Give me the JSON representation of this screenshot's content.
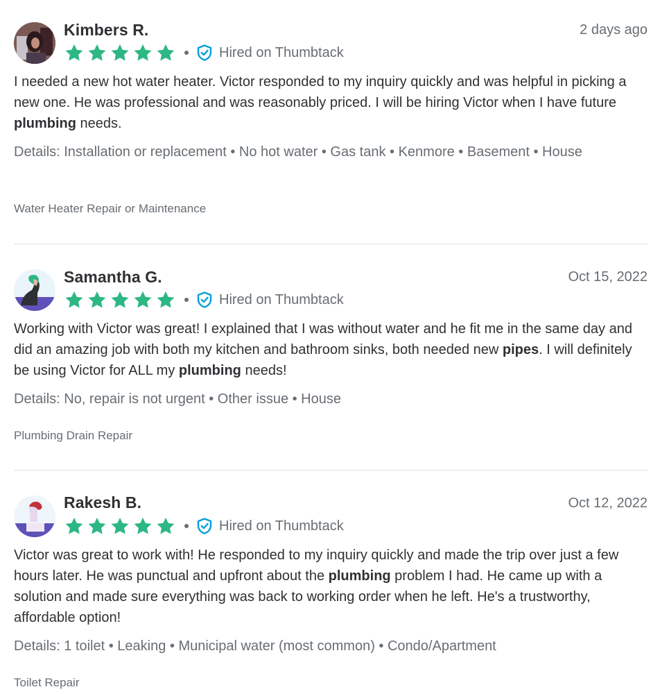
{
  "reviews": [
    {
      "name": "Kimbers R.",
      "date": "2 days ago",
      "rating": 5,
      "hired_label": "Hired on Thumbtack",
      "body": [
        {
          "t": "I needed a new hot water heater. Victor responded to my inquiry quickly and was helpful in picking a new one. He was professional and was reasonably priced. I will be hiring Victor when I have future ",
          "b": false
        },
        {
          "t": "plumbing",
          "b": true
        },
        {
          "t": " needs.",
          "b": false
        }
      ],
      "details": "Details: Installation or replacement • No hot water • Gas tank • Kenmore • Basement • House",
      "category": "Water Heater Repair or Maintenance",
      "avatar": "photo"
    },
    {
      "name": "Samantha G.",
      "date": "Oct 15, 2022",
      "rating": 5,
      "hired_label": "Hired on Thumbtack",
      "body": [
        {
          "t": "Working with Victor was great! I explained that I was without water and he fit me in the same day and did an amazing job with both my kitchen and bathroom sinks, both needed new ",
          "b": false
        },
        {
          "t": "pipes",
          "b": true
        },
        {
          "t": ". I will definitely be using Victor for ALL my ",
          "b": false
        },
        {
          "t": "plumbing",
          "b": true
        },
        {
          "t": " needs!",
          "b": false
        }
      ],
      "details": "Details: No, repair is not urgent • Other issue • House",
      "category": "Plumbing Drain Repair",
      "avatar": "illustration-green"
    },
    {
      "name": "Rakesh B.",
      "date": "Oct 12, 2022",
      "rating": 5,
      "hired_label": "Hired on Thumbtack",
      "body": [
        {
          "t": "Victor was great to work with! He responded to my inquiry quickly and made the trip over just a few hours later. He was punctual and upfront about the ",
          "b": false
        },
        {
          "t": "plumbing",
          "b": true
        },
        {
          "t": " problem I had. He came up with a solution and made sure everything was back to working order when he left. He's a trustworthy, affordable option!",
          "b": false
        }
      ],
      "details": "Details: 1 toilet • Leaking • Municipal water (most common) • Condo/Apartment",
      "category": "Toilet Repair",
      "avatar": "illustration-red"
    }
  ],
  "colors": {
    "star": "#2db783",
    "shield": "#009fd9",
    "muted_text": "#676d73",
    "body_text": "#2f3033",
    "divider": "#e0e0e0"
  },
  "icons": {
    "star": "star-icon",
    "shield": "verified-shield-icon"
  }
}
